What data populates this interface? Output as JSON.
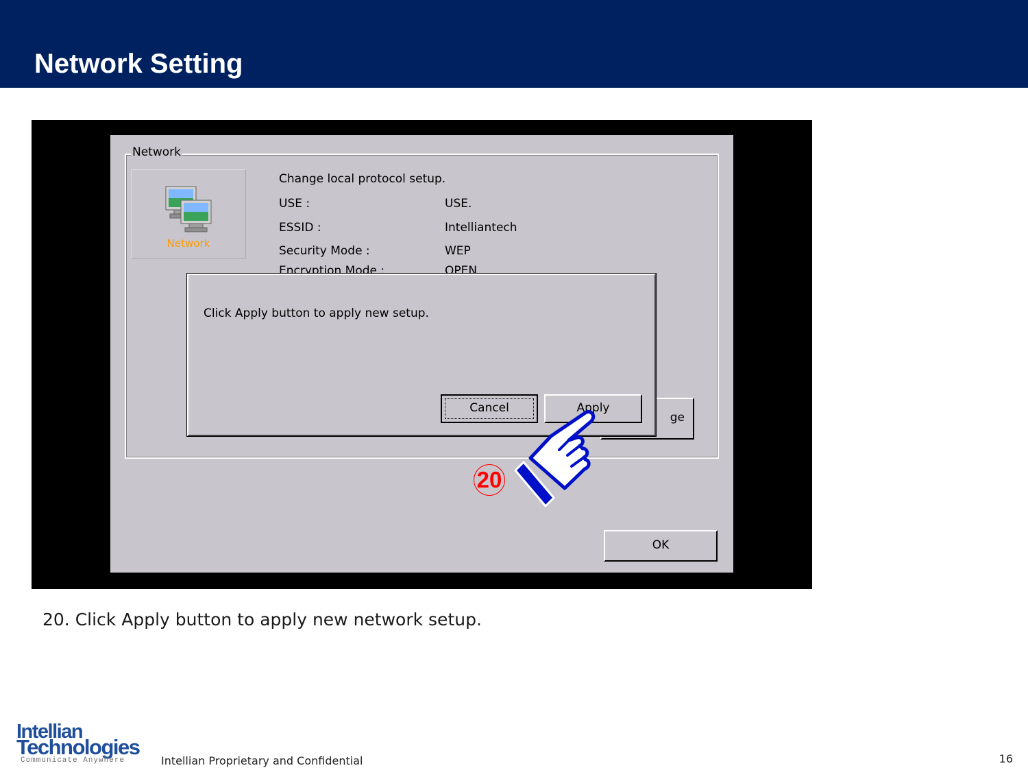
{
  "header": {
    "title": "Network Setting"
  },
  "window": {
    "group_label": "Network",
    "icon_label": "Network",
    "heading": "Change local protocol setup.",
    "rows": [
      {
        "label": "USE :",
        "value": "USE."
      },
      {
        "label": "ESSID :",
        "value": "Intelliantech"
      },
      {
        "label": "Security Mode :",
        "value": "WEP"
      },
      {
        "label": "Encryption Mode :",
        "value": "OPEN"
      }
    ],
    "change_label": "ge",
    "ok_label": "OK"
  },
  "dialog": {
    "message": "Click Apply button to apply new setup.",
    "cancel_label": "Cancel",
    "apply_label": "Apply"
  },
  "annotation": {
    "step": "20",
    "icon": "pointing-hand-icon"
  },
  "caption": "20. Click Apply button to apply new network setup.",
  "footer": {
    "logo_line1": "Intellian",
    "logo_line2": "Technologies",
    "logo_tagline": "Communicate Anywhere",
    "text": "Intellian Proprietary and Confidential",
    "page": "16"
  },
  "colors": {
    "header_bg": "#00215f",
    "window_bg": "#c8c6cc",
    "badge": "#ff0000",
    "hand": "#0010c8",
    "icon_label": "#ff9900"
  }
}
